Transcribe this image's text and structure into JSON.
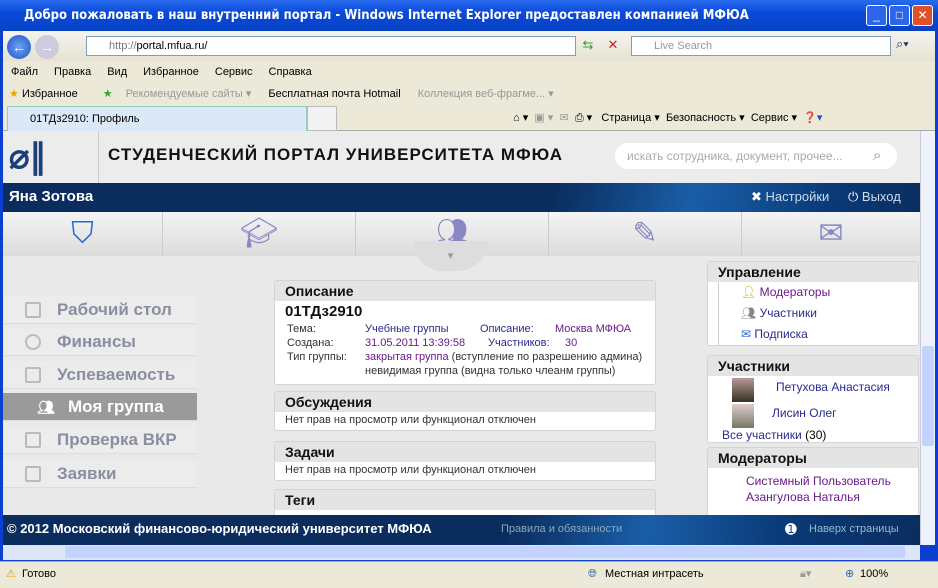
{
  "window": {
    "title": "Добро пожаловать в наш внутренний портал - Windows Internet Explorer предоставлен компанией МФЮА"
  },
  "address": {
    "url_prefix": "http://",
    "url_host": "portal.mfua.ru/",
    "search_placeholder": "Live Search"
  },
  "menubar": [
    "Файл",
    "Правка",
    "Вид",
    "Избранное",
    "Сервис",
    "Справка"
  ],
  "favorites": {
    "label": "Избранное",
    "links": [
      "Рекомендуемые сайты ▾",
      "Бесплатная почта Hotmail",
      "Коллекция веб-фрагме... ▾"
    ]
  },
  "tab": {
    "label": "01ТДз2910: Профиль"
  },
  "commandbar": [
    "Страница ▾",
    "Безопасность ▾",
    "Сервис ▾"
  ],
  "portal": {
    "title": "СТУДЕНЧЕСКИЙ ПОРТАЛ УНИВЕРСИТЕТА МФЮА",
    "search_placeholder": "искать сотрудника, документ, прочее...",
    "user": "Яна Зотова",
    "settings": "Настройки",
    "logout": "Выход"
  },
  "left_menu": [
    {
      "label": "Рабочий стол"
    },
    {
      "label": "Финансы"
    },
    {
      "label": "Успеваемость"
    },
    {
      "label": "Моя группа",
      "active": true
    },
    {
      "label": "Проверка ВКР"
    },
    {
      "label": "Заявки"
    }
  ],
  "description": {
    "header": "Описание",
    "group": "01ТДз2910",
    "theme_label": "Тема:",
    "theme": "Учебные группы",
    "desc_label": "Описание:",
    "desc": "Москва МФЮА",
    "created_label": "Создана:",
    "created": "31.05.2011 13:39:58",
    "members_label": "Участников:",
    "members": "30",
    "type_label": "Тип группы:",
    "type1": "закрытая группа",
    "type1_note": "(вступление по разрешению админа)",
    "type2": "невидимая группа (видна только члеанм группы)"
  },
  "discussions": {
    "header": "Обсуждения",
    "text": "Нет прав на просмотр или функционал отключен"
  },
  "tasks": {
    "header": "Задачи",
    "text": "Нет прав на просмотр или функционал отключен"
  },
  "tags": {
    "header": "Теги"
  },
  "management": {
    "header": "Управление",
    "items": [
      "Модераторы",
      "Участники",
      "Подписка"
    ]
  },
  "members": {
    "header": "Участники",
    "people": [
      "Петухова Анастасия",
      "Лисин Олег"
    ],
    "all": "Все участники",
    "count": "(30)"
  },
  "moderators": {
    "header": "Модераторы",
    "people": [
      "Системный Пользователь",
      "Азангулова Наталья"
    ]
  },
  "footer": {
    "copyright": "© 2012 Московский финансово-юридический университет МФЮА",
    "rules": "Правила и обязанности",
    "top": "Наверх страницы"
  },
  "statusbar": {
    "status": "Готово",
    "zone": "Местная интрасеть",
    "zoom": "100%"
  }
}
